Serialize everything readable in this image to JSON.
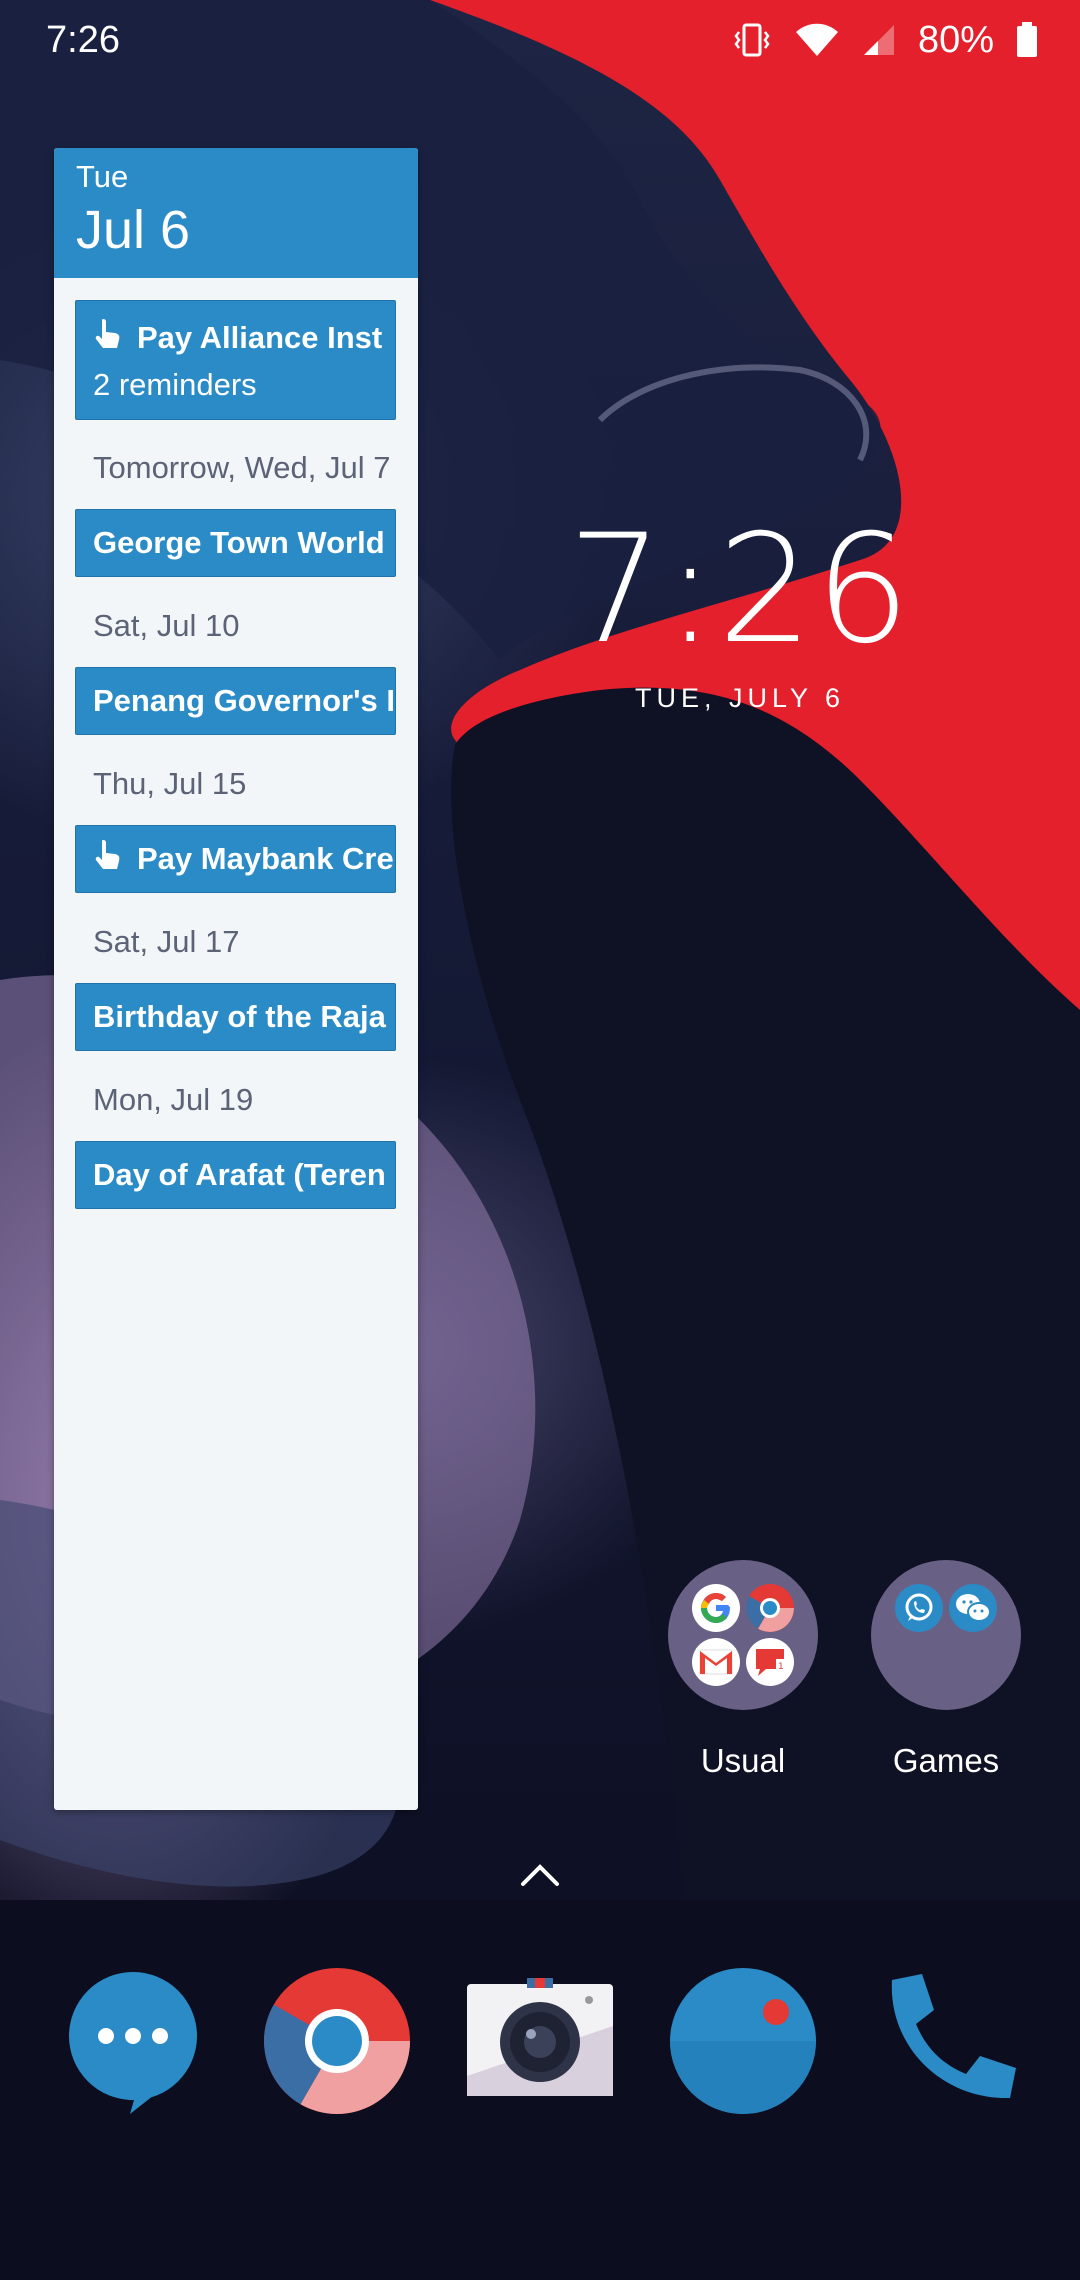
{
  "status_bar": {
    "time": "7:26",
    "battery_percent": "80%",
    "icons": [
      "vibrate-icon",
      "wifi-icon",
      "signal-icon",
      "battery-icon"
    ]
  },
  "calendar_widget": {
    "weekday": "Tue",
    "date": "Jul 6",
    "accent_color": "#2a8bc6",
    "entries": [
      {
        "type": "event",
        "title": "Pay Alliance Inst",
        "subtitle": "2 reminders",
        "icon": "reminder-hand-icon"
      },
      {
        "type": "day",
        "label": "Tomorrow, Wed, Jul 7"
      },
      {
        "type": "event",
        "title": "George Town World"
      },
      {
        "type": "day",
        "label": "Sat, Jul 10"
      },
      {
        "type": "event",
        "title": "Penang Governor's I"
      },
      {
        "type": "day",
        "label": "Thu, Jul 15"
      },
      {
        "type": "event",
        "title": "Pay Maybank Cre",
        "icon": "reminder-hand-icon"
      },
      {
        "type": "day",
        "label": "Sat, Jul 17"
      },
      {
        "type": "event",
        "title": "Birthday of the Raja"
      },
      {
        "type": "day",
        "label": "Mon, Jul 19"
      },
      {
        "type": "event",
        "title": "Day of Arafat (Teren"
      }
    ]
  },
  "clock": {
    "time": "7:26",
    "date": "TUE, JULY 6"
  },
  "folders": [
    {
      "label": "Usual",
      "apps": [
        "google-icon",
        "chrome-icon",
        "gmail-icon",
        "messages-icon"
      ]
    },
    {
      "label": "Games",
      "apps": [
        "whatsapp-icon",
        "wechat-icon"
      ]
    }
  ],
  "dock": {
    "apps": [
      "messages-app-icon",
      "chrome-app-icon",
      "camera-app-icon",
      "assistant-app-icon",
      "phone-app-icon"
    ]
  }
}
